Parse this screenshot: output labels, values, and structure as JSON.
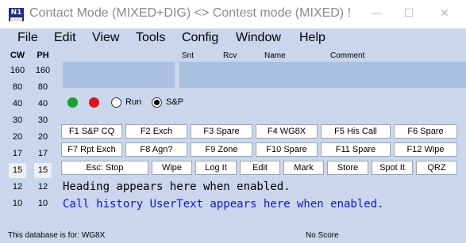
{
  "window": {
    "title": "Contact Mode (MIXED+DIG) <> Contest mode (MIXED) !",
    "icon_text": "N1",
    "minimize_glyph": "—",
    "maximize_glyph": "☐",
    "close_glyph": "✕"
  },
  "menu": [
    "File",
    "Edit",
    "View",
    "Tools",
    "Config",
    "Window",
    "Help"
  ],
  "bands": {
    "cw_header": "CW",
    "ph_header": "PH",
    "cw": [
      "160",
      "80",
      "40",
      "30",
      "20",
      "17",
      "15",
      "12",
      "10"
    ],
    "ph": [
      "160",
      "80",
      "40",
      "30",
      "20",
      "17",
      "15",
      "12",
      "10"
    ]
  },
  "entry": {
    "snt_label": "Snt",
    "rcv_label": "Rcv",
    "name_label": "Name",
    "comment_label": "Comment",
    "call_value": "",
    "snt_value": "",
    "rcv_value": "",
    "name_value": "",
    "comment_value": ""
  },
  "indicators": {
    "green": "#16a12a",
    "red": "#e0141c",
    "run_label": "Run",
    "sp_label": "S&P",
    "selected": "S&P"
  },
  "function_keys": {
    "row1": [
      "F1 S&P CQ",
      "F2 Exch",
      "F3 Spare",
      "F4 WG8X",
      "F5 His Call",
      "F6 Spare"
    ],
    "row2": [
      "F7 Rpt Exch",
      "F8 Agn?",
      "F9 Zone",
      "F10 Spare",
      "F11 Spare",
      "F12 Wipe"
    ],
    "row3": [
      "Esc: Stop",
      "Wipe",
      "Log It",
      "Edit",
      "Mark",
      "Store",
      "Spot It",
      "QRZ"
    ]
  },
  "info": {
    "heading": "Heading appears here when enabled.",
    "call_history": "Call history UserText appears here when enabled."
  },
  "status": {
    "database": "This database is for: WG8X",
    "score": "No Score"
  }
}
